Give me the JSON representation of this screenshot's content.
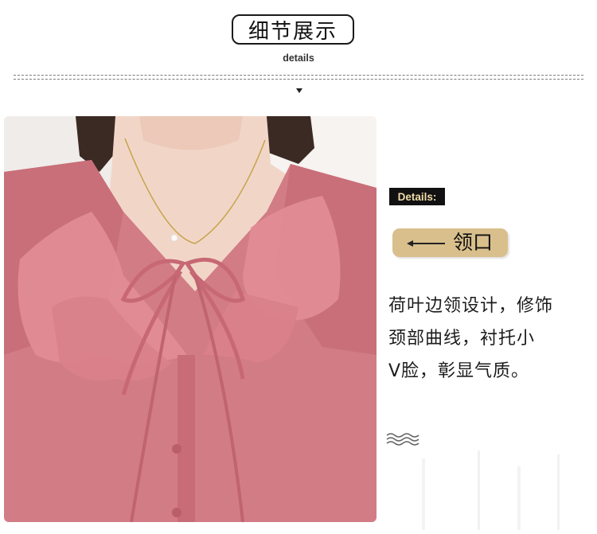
{
  "header": {
    "title": "细节展示",
    "subtitle": "details"
  },
  "photo": {
    "subject": "pink-ruffle-blouse-neckline",
    "colors": {
      "fabric": "#d07a84",
      "skin": "#f3d8cb",
      "background": "#f2efec"
    }
  },
  "details_tag": "Details:",
  "feature_label": "领口",
  "description": [
    "荷叶边领设计，修饰",
    "颈部曲线，衬托小",
    "V脸，彰显气质。"
  ],
  "colors": {
    "gold_label": "#d9bf8c",
    "tag_bg": "#111111",
    "tag_text": "#f0dca8"
  }
}
